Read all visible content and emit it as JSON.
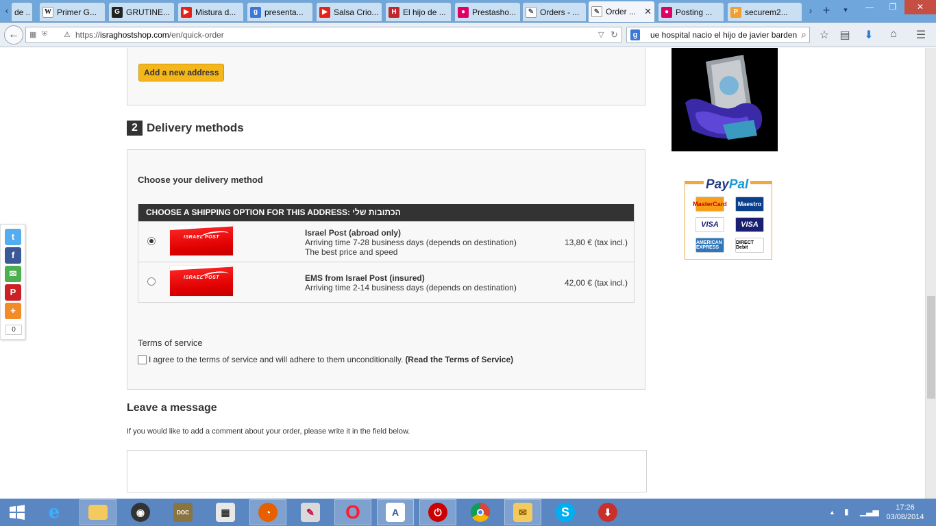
{
  "browser": {
    "tabs": [
      {
        "label": "de ...",
        "favicon": "page-icon",
        "fav_color": "#7a7a7a"
      },
      {
        "label": "Primer G...",
        "favicon": "wikipedia-icon",
        "fav_color": "#ffffff"
      },
      {
        "label": "GRUTINE...",
        "favicon": "g-icon",
        "fav_color": "#222222"
      },
      {
        "label": "Mistura d...",
        "favicon": "youtube-icon",
        "fav_color": "#e62117"
      },
      {
        "label": "presenta...",
        "favicon": "google-icon",
        "fav_color": "#3c78d8"
      },
      {
        "label": "Salsa Crio...",
        "favicon": "youtube-icon",
        "fav_color": "#e62117"
      },
      {
        "label": "El hijo de ...",
        "favicon": "news-icon",
        "fav_color": "#c0262d"
      },
      {
        "label": "Prestasho...",
        "favicon": "prestashop-icon",
        "fav_color": "#df0067"
      },
      {
        "label": "Orders - ...",
        "favicon": "pen-icon",
        "fav_color": "#555555"
      },
      {
        "label": "Order ...",
        "favicon": "pen-icon",
        "fav_color": "#555555",
        "active": true
      },
      {
        "label": "Posting ...",
        "favicon": "prestashop-icon",
        "fav_color": "#df0067"
      },
      {
        "label": "securem2...",
        "favicon": "pma-icon",
        "fav_color": "#f0a030"
      }
    ],
    "url_prefix": "https://",
    "url_host": "israghostshop.com",
    "url_path": "/en/quick-order",
    "search_engine": "g",
    "search_text": "ue hospital nacio el hijo de javier barden"
  },
  "page": {
    "add_address_label": "Add a new address",
    "delivery_step_number": "2",
    "delivery_step_title": "Delivery methods",
    "choose_label": "Choose your delivery method",
    "shipping_header": "CHOOSE A SHIPPING OPTION FOR THIS ADDRESS: הכתובות שלי",
    "carrier_logo_text": "ISRAEL POST",
    "carriers": [
      {
        "name": "Israel Post (abroad only)",
        "line1": "Arriving time 7-28 business days (depends on destination)",
        "line2": "The best price and speed",
        "price": "13,80 € (tax incl.)",
        "selected": true
      },
      {
        "name": "EMS from Israel Post (insured)",
        "line1": "Arriving time 2-14 business days (depends on destination)",
        "line2": "",
        "price": "42,00 € (tax incl.)",
        "selected": false
      }
    ],
    "terms_title": "Terms of service",
    "terms_agree": "I agree to the terms of service and will adhere to them unconditionally.",
    "terms_link": "(Read the Terms of Service)",
    "message_title": "Leave a message",
    "message_hint": "If you would like to add a comment about your order, please write it in the field below.",
    "message_value": ""
  },
  "sidebar": {
    "paypal_logo_1": "Pay",
    "paypal_logo_2": "Pal",
    "cards": [
      "MasterCard",
      "Maestro",
      "VISA",
      "VISA",
      "AMERICAN EXPRESS",
      "DIRECT Debit"
    ]
  },
  "share": {
    "buttons": [
      "twitter-icon",
      "facebook-icon",
      "email-icon",
      "pinterest-icon",
      "share-icon"
    ],
    "count": "0"
  },
  "taskbar": {
    "time": "17:26",
    "date": "03/08/2014"
  }
}
